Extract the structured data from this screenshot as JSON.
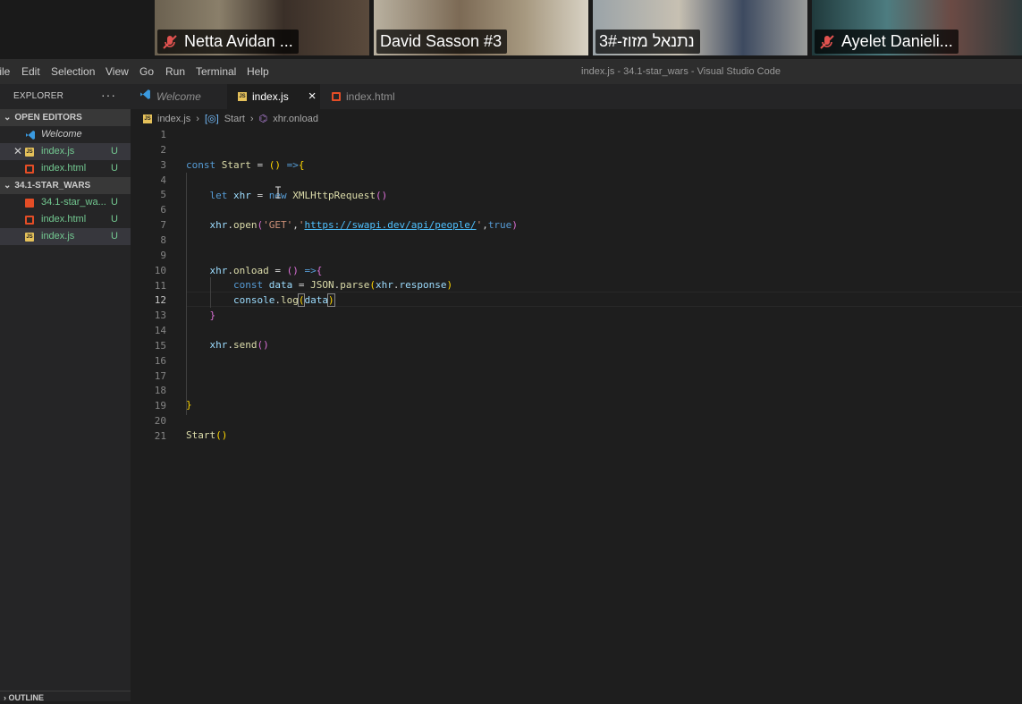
{
  "participants": [
    {
      "name": "Netta Avidan ...",
      "muted": true
    },
    {
      "name": "David Sasson #3",
      "muted": false
    },
    {
      "name": "נתנאל מזוז-3#",
      "muted": false
    },
    {
      "name": "Ayelet Danieli...",
      "muted": true
    }
  ],
  "menu": [
    "File",
    "Edit",
    "Selection",
    "View",
    "Go",
    "Run",
    "Terminal",
    "Help"
  ],
  "window_title": "index.js - 34.1-star_wars - Visual Studio Code",
  "sidebar": {
    "title": "EXPLORER",
    "more": "···",
    "open_editors_label": "OPEN EDITORS",
    "open_editors": [
      {
        "label": "Welcome",
        "icon": "vscode-icon",
        "status": ""
      },
      {
        "label": "index.js",
        "icon": "js-file-icon",
        "status": "U"
      },
      {
        "label": "index.html",
        "icon": "html-file-icon",
        "status": "U"
      }
    ],
    "folder_label": "34.1-STAR_WARS",
    "folder_files": [
      {
        "label": "34.1-star_wa...",
        "icon": "pdf-file-icon",
        "status": "U"
      },
      {
        "label": "index.html",
        "icon": "html-file-icon",
        "status": "U"
      },
      {
        "label": "index.js",
        "icon": "js-file-icon",
        "status": "U"
      }
    ],
    "outline_label": "OUTLINE"
  },
  "tabs": [
    {
      "label": "Welcome",
      "icon": "vscode-icon"
    },
    {
      "label": "index.js",
      "icon": "js-file-icon",
      "close": "×"
    },
    {
      "label": "index.html",
      "icon": "html-file-icon"
    }
  ],
  "breadcrumb": [
    "index.js",
    "Start",
    "xhr.onload"
  ],
  "line_numbers": [
    "1",
    "2",
    "3",
    "4",
    "5",
    "6",
    "7",
    "8",
    "9",
    "10",
    "11",
    "12",
    "13",
    "14",
    "15",
    "16",
    "17",
    "18",
    "19",
    "20",
    "21"
  ],
  "current_line": "12",
  "colors": {
    "accent": "#0e639c",
    "untracked": "#73c991",
    "js_icon": "#e5c15a",
    "html_icon": "#e44d26"
  }
}
